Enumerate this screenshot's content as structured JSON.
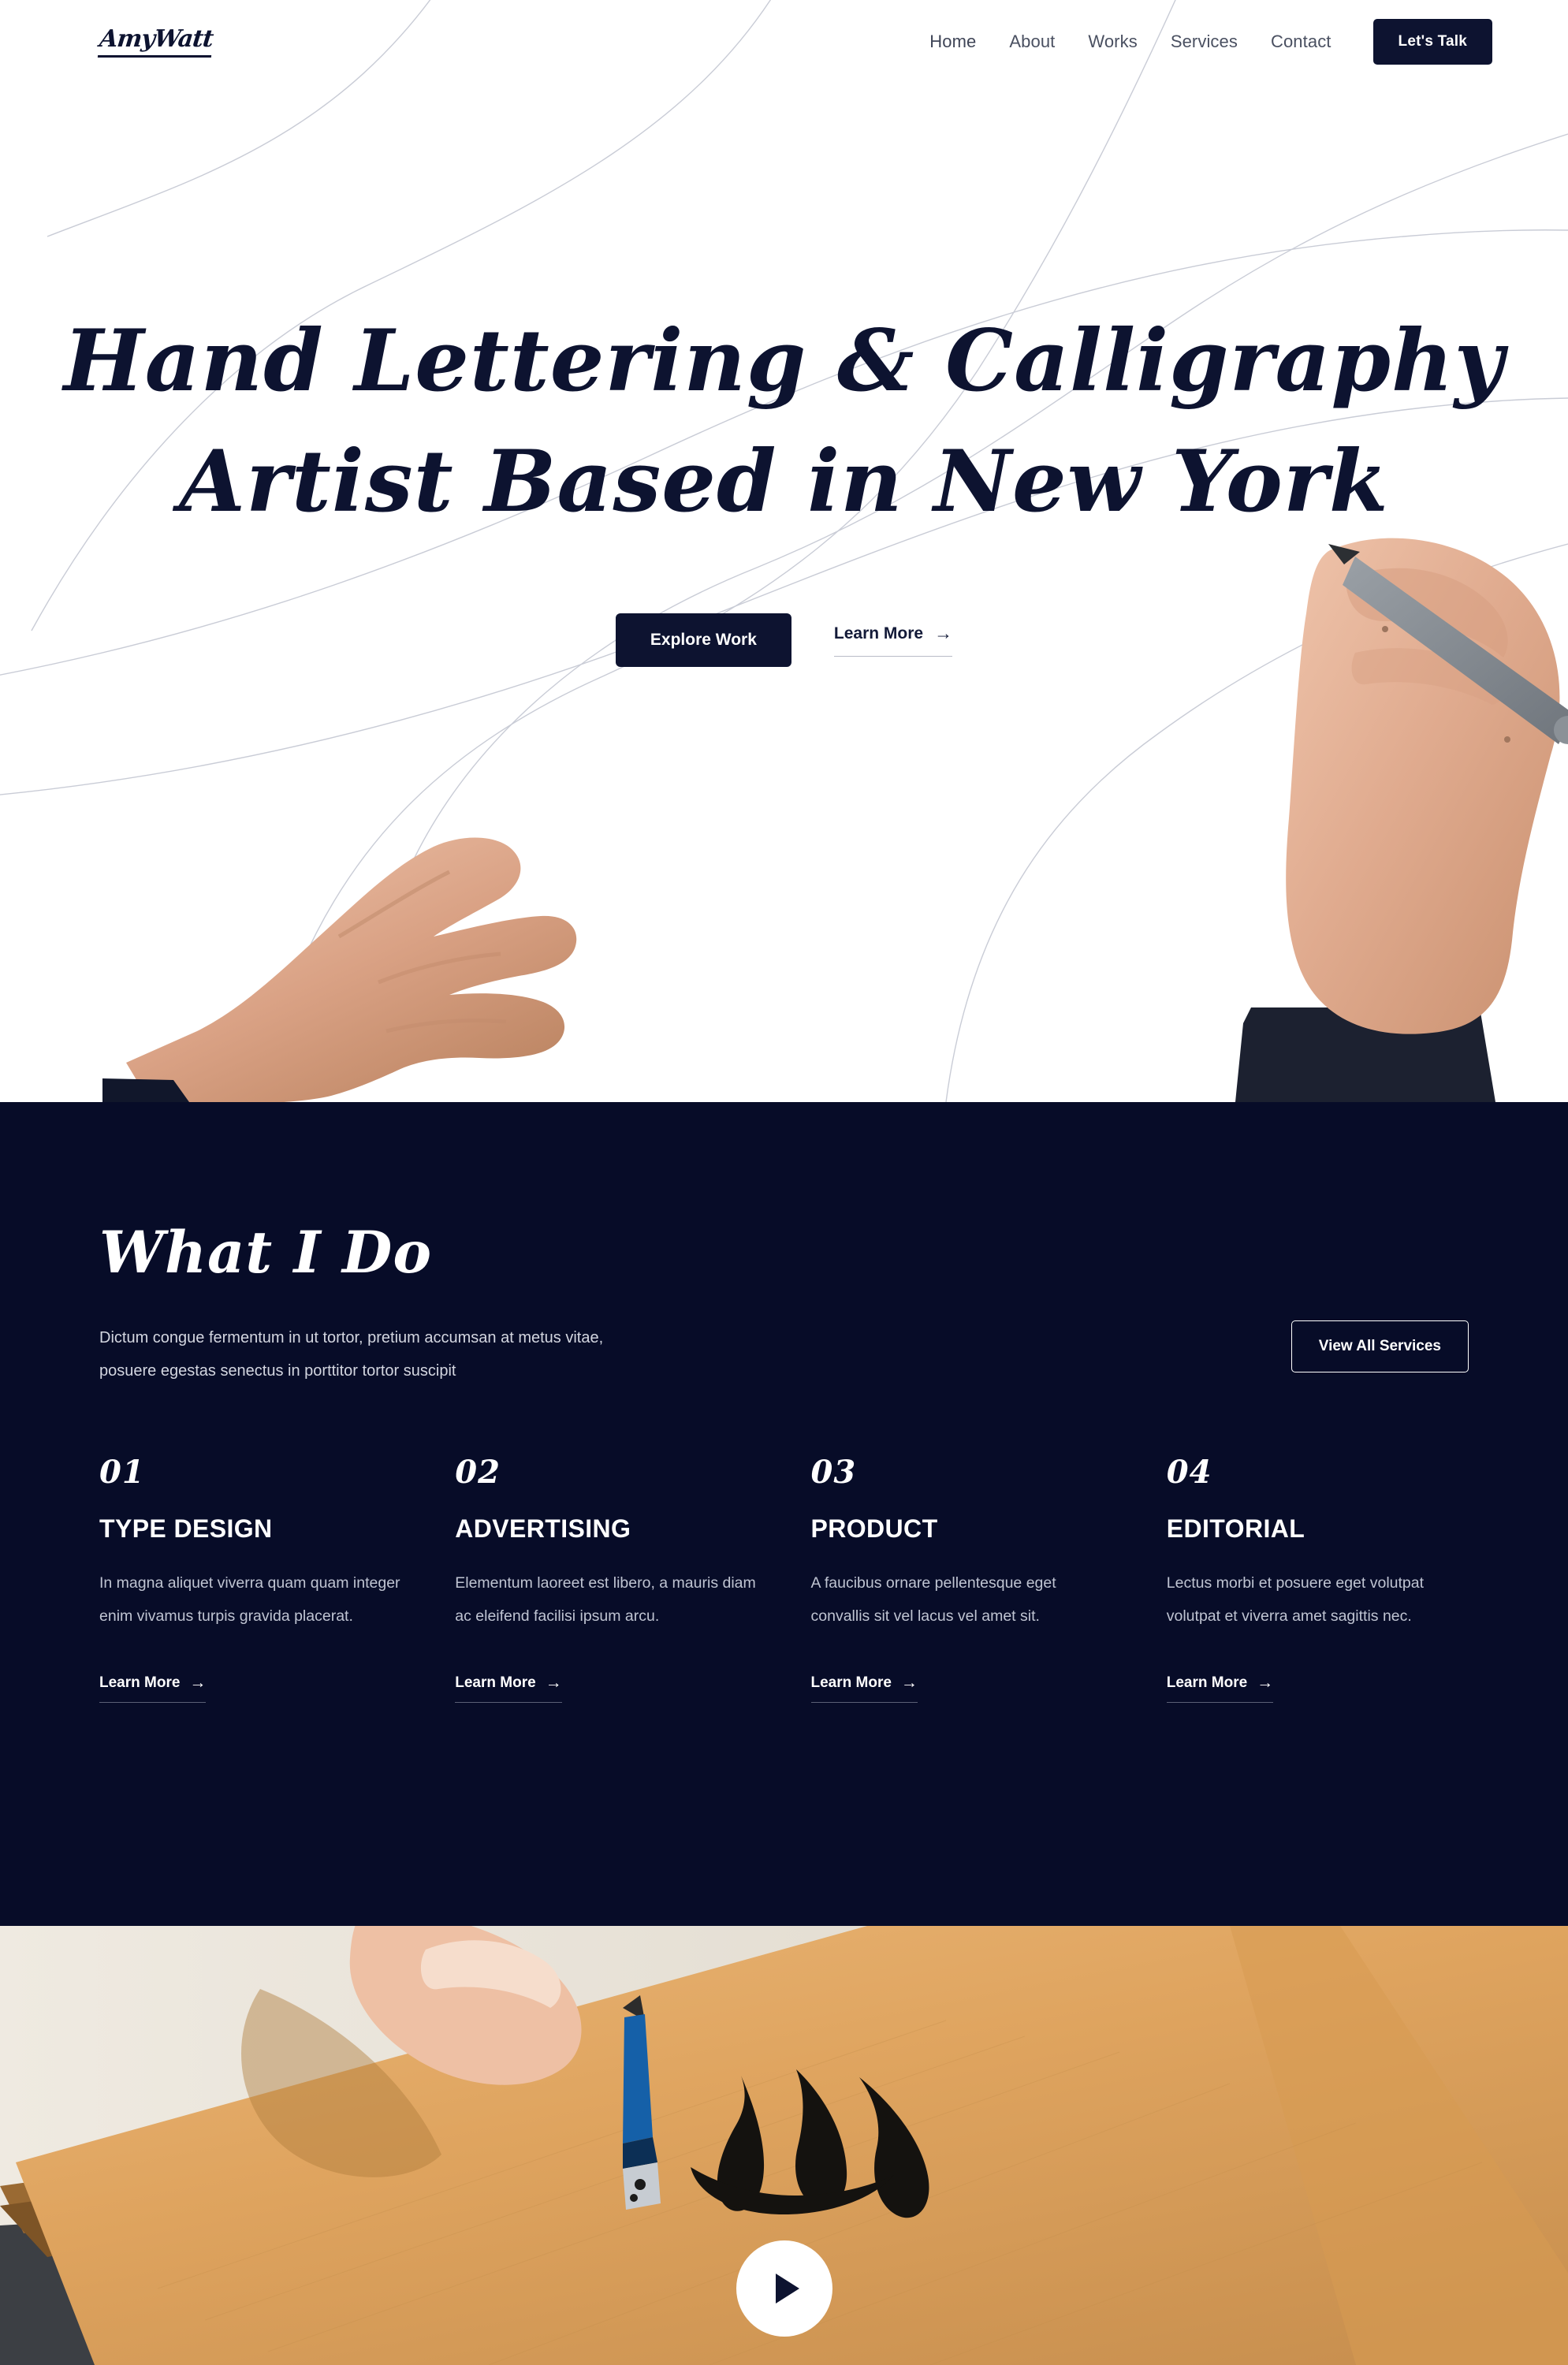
{
  "theme": {
    "dark_navy": "#070c28",
    "ink": "#0d1330",
    "white": "#ffffff",
    "muted_text": "#bfc4d2",
    "paper": "#d79a4f"
  },
  "header": {
    "logo": "AmyWatt",
    "nav": [
      {
        "label": "Home"
      },
      {
        "label": "About"
      },
      {
        "label": "Works"
      },
      {
        "label": "Services"
      },
      {
        "label": "Contact"
      }
    ],
    "cta_label": "Let's Talk"
  },
  "hero": {
    "title_line1": "Hand Lettering & Calligraphy",
    "title_line2": "Artist Based in New York",
    "primary_button": "Explore Work",
    "secondary_link": "Learn More",
    "secondary_arrow": "→"
  },
  "services": {
    "title": "What I Do",
    "subtitle_line1": "Dictum congue fermentum in ut tortor, pretium accumsan at metus vitae,",
    "subtitle_line2": "posuere egestas senectus in porttitor tortor suscipit",
    "view_all_label": "View All Services",
    "learn_more_label": "Learn More",
    "learn_more_arrow": "→",
    "items": [
      {
        "number": "01",
        "name": "TYPE DESIGN",
        "desc": "In magna aliquet viverra quam quam integer enim vivamus turpis gravida placerat.",
        "link": "Learn More"
      },
      {
        "number": "02",
        "name": "ADVERTISING",
        "desc": "Elementum laoreet est libero, a mauris diam ac eleifend facilisi ipsum arcu.",
        "link": "Learn More"
      },
      {
        "number": "03",
        "name": "PRODUCT",
        "desc": "A faucibus ornare pellentesque eget convallis sit vel lacus vel amet sit.",
        "link": "Learn More"
      },
      {
        "number": "04",
        "name": "EDITORIAL",
        "desc": "Lectus morbi et posuere eget volutpat volutpat et viverra amet sagittis nec.",
        "link": "Learn More"
      }
    ]
  },
  "video": {
    "play_icon": "play-icon"
  }
}
